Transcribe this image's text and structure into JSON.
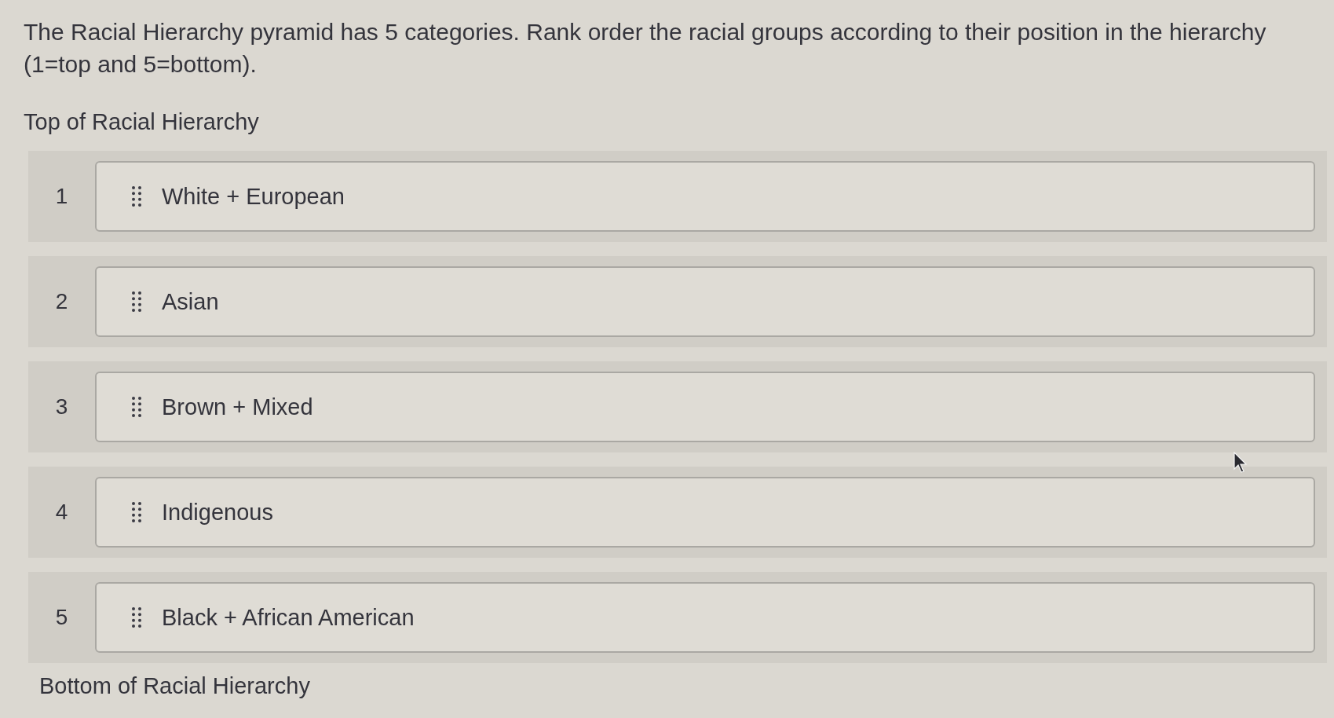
{
  "question": {
    "text": "The Racial Hierarchy pyramid has 5 categories. Rank order the racial groups according to their position in the hierarchy (1=top and 5=bottom)."
  },
  "top_label": "Top of Racial Hierarchy",
  "ranking": [
    {
      "rank": "1",
      "label": "White + European"
    },
    {
      "rank": "2",
      "label": "Asian"
    },
    {
      "rank": "3",
      "label": "Brown + Mixed"
    },
    {
      "rank": "4",
      "label": "Indigenous"
    },
    {
      "rank": "5",
      "label": "Black + African American"
    }
  ],
  "bottom_label": "Bottom of Racial Hierarchy"
}
